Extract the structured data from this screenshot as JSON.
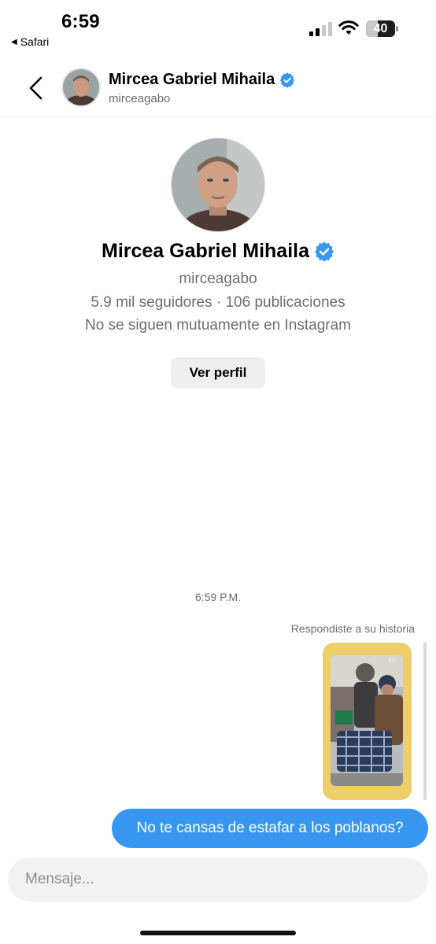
{
  "status_bar": {
    "time": "6:59",
    "back_app_label": "Safari",
    "battery_percent": "40",
    "battery_level": 0.4
  },
  "header": {
    "name": "Mircea Gabriel Mihaila",
    "username": "mirceagabo",
    "verified": true
  },
  "profile": {
    "name": "Mircea Gabriel Mihaila",
    "username": "mirceagabo",
    "stats": "5.9 mil seguidores · 106 publicaciones",
    "relationship": "No se siguen mutuamente en Instagram",
    "view_profile_label": "Ver perfil"
  },
  "conversation": {
    "timestamp": "6:59 P.M.",
    "story_reply_label": "Respondiste a su historia",
    "message": "No te cansas de estafar a los poblanos?"
  },
  "composer": {
    "placeholder": "Mensaje..."
  },
  "colors": {
    "accent_blue": "#3797f0",
    "verified_blue": "#3897f0",
    "story_frame": "#eccf6a"
  },
  "icons": [
    "back-chevron-icon",
    "signal-icon",
    "wifi-icon",
    "battery-icon",
    "verified-badge-icon"
  ]
}
